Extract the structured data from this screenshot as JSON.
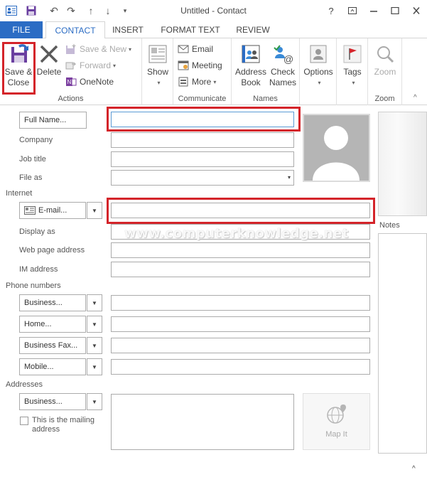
{
  "window": {
    "title": "Untitled - Contact",
    "help": "?"
  },
  "tabs": [
    {
      "label": "FILE"
    },
    {
      "label": "CONTACT"
    },
    {
      "label": "INSERT"
    },
    {
      "label": "FORMAT TEXT"
    },
    {
      "label": "REVIEW"
    }
  ],
  "ribbon": {
    "actions": {
      "label": "Actions",
      "save_close_line1": "Save &",
      "save_close_line2": "Close",
      "delete": "Delete",
      "save_new": "Save & New",
      "forward": "Forward",
      "onenote": "OneNote"
    },
    "show": {
      "label": "Show"
    },
    "communicate": {
      "label": "Communicate",
      "email": "Email",
      "meeting": "Meeting",
      "more": "More"
    },
    "names": {
      "label": "Names",
      "address_book_line1": "Address",
      "address_book_line2": "Book",
      "check_names_line1": "Check",
      "check_names_line2": "Names"
    },
    "options": {
      "label": "Options"
    },
    "tags": {
      "label": "Tags"
    },
    "zoom": {
      "button": "Zoom",
      "label": "Zoom"
    }
  },
  "form": {
    "full_name_button": "Full Name...",
    "company": "Company",
    "job_title": "Job title",
    "file_as": "File as",
    "internet": "Internet",
    "email_button": "E-mail...",
    "display_as": "Display as",
    "web_page": "Web page address",
    "im_address": "IM address",
    "phone_numbers": "Phone numbers",
    "phones": [
      {
        "label": "Business..."
      },
      {
        "label": "Home..."
      },
      {
        "label": "Business Fax..."
      },
      {
        "label": "Mobile..."
      }
    ],
    "addresses": "Addresses",
    "address_button": "Business...",
    "mailing_line1": "This is the mailing",
    "mailing_line2": "address",
    "map_it": "Map It",
    "notes": "Notes",
    "watermark": "www.computerknowledge.net"
  },
  "colors": {
    "accent": "#2b6cc4",
    "highlight": "#d4242a"
  }
}
